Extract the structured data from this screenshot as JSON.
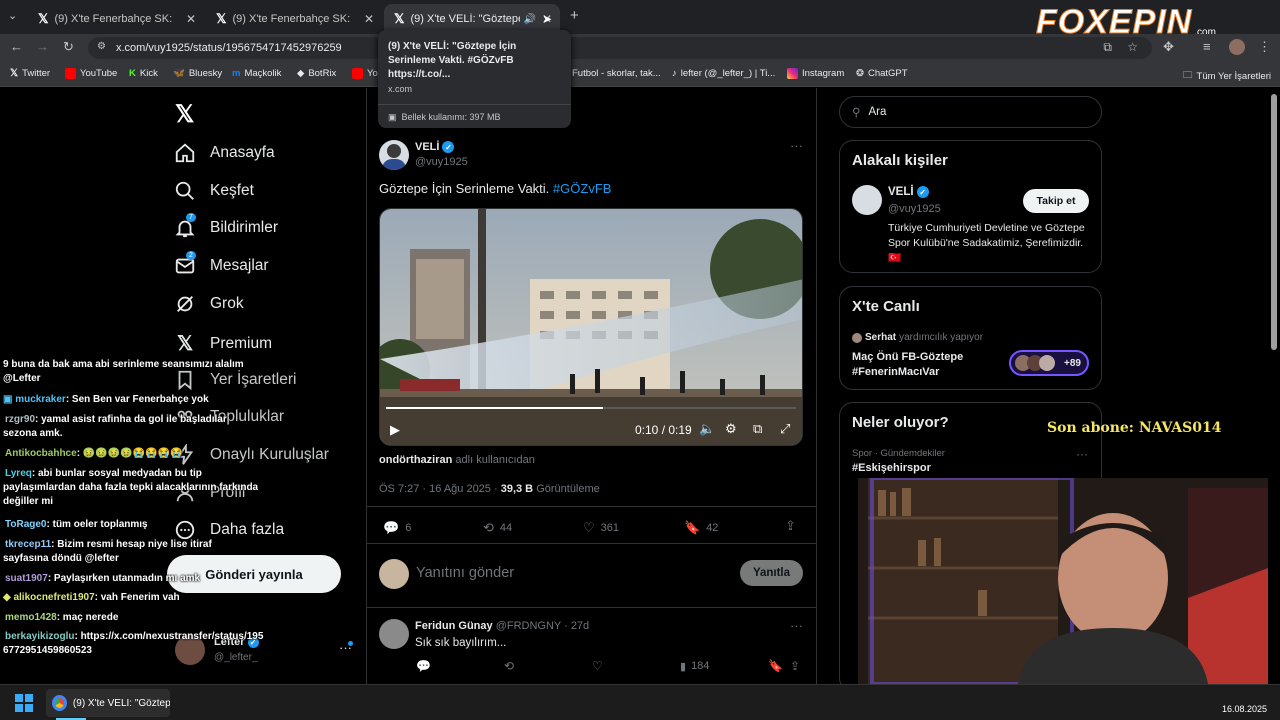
{
  "browser": {
    "tabs": [
      {
        "title": "(9) X'te Fenerbahçe SK: \"Göztepe"
      },
      {
        "title": "(9) X'te Fenerbahçe SK: \"Sen be"
      },
      {
        "title": "(9) X'te VELİ: \"Göztepe İçin"
      }
    ],
    "url": "x.com/vuy1925/status/1956754717452976259",
    "tooltip": {
      "title": "(9) X'te VELİ: \"Göztepe İçin Serinleme Vakti. #GÖZvFB https://t.co/...",
      "domain": "x.com",
      "memory": "Bellek kullanımı: 397 MB"
    },
    "bookmarks": [
      "Twitter",
      "YouTube",
      "Kick",
      "Bluesky",
      "Maçkolik",
      "BotRix",
      "Yo",
      "Futbol - skorlar, tak...",
      "lefter (@_lefter_) | Ti...",
      "Instagram",
      "ChatGPT"
    ],
    "all_bookmarks": "Tüm Yer İşaretleri"
  },
  "brand": {
    "watermark": "FOXEPIN",
    "watermark_suffix": ".com"
  },
  "nav": {
    "items": [
      "Anasayfa",
      "Keşfet",
      "Bildirimler",
      "Mesajlar",
      "Grok",
      "Premium",
      "Yer İşaretleri",
      "Topluluklar",
      "Onaylı Kuruluşlar",
      "Profil",
      "Daha fazla"
    ],
    "bildirim_badge": "7",
    "mesaj_badge": "2",
    "post_button": "Gönderi yayınla",
    "account_name": "Lefter",
    "account_handle": "@_lefter_"
  },
  "tweet": {
    "author": "VELİ",
    "handle": "@vuy1925",
    "text": "Göztepe İçin Serinleme Vakti.",
    "hashtag": "#GÖZvFB",
    "video_time": "0:10 / 0:19",
    "progress": 0.53,
    "attribution_user": "ondörthaziran",
    "attribution_rest": "adlı kullanıcıdan",
    "timestamp": "ÖS 7:27 · 16 Ağu 2025 ·",
    "views": "39,3 B",
    "views_label": "Görüntüleme",
    "replies": "6",
    "retweets": "44",
    "likes": "361",
    "bookmarks": "42",
    "reply_placeholder": "Yanıtını gönder",
    "reply_button": "Yanıtla"
  },
  "reply1": {
    "author": "Feridun Günay",
    "handle": "@FRDNGNY · 27d",
    "text": "Sık sık bayılırım...",
    "views": "184"
  },
  "right": {
    "search_placeholder": "Ara",
    "related_title": "Alakalı kişiler",
    "related_name": "VELİ",
    "related_handle": "@vuy1925",
    "follow_button": "Takip et",
    "related_bio": "Türkiye Cumhuriyeti Devletine ve Göztepe Spor Kulübü'ne Sadakatimiz, Şerefimizdir. 🇹🇷",
    "live_title": "X'te Canlı",
    "live_host": "Serhat",
    "live_host_status": "yardımcılık yapıyor",
    "live_topic": "Maç Önü  FB-Göztepe #FenerinMacıVar",
    "live_count": "+89",
    "trends_title": "Neler oluyor?",
    "trend1_meta": "Spor · Gündemdekiler",
    "trend1_tag": "#Eskişehirspor"
  },
  "stream": {
    "last_sub": "Son abone: NAVAS014"
  },
  "chat": [
    {
      "user": "",
      "color": "#ffffff",
      "msg": "9 buna da bak ama abi serinleme seansımızı alalım @Lefter"
    },
    {
      "user": "muckraker",
      "color": "#4fc3f7",
      "msg": ": Sen Ben var Fenerbahçe yok"
    },
    {
      "user": "rzgr90",
      "color": "#b0bec5",
      "msg": ": yamal asist rafinha da gol ile başladılar sezona amk."
    },
    {
      "user": "Antikocbahhce",
      "color": "#9ccc65",
      "msg": ": 🤢🤢🤢🤢😭😭😭😭"
    },
    {
      "user": "Lyreq",
      "color": "#4dd0e1",
      "msg": ": abi bunlar sosyal medyadan bu tip paylaşımlardan daha fazla tepki alacaklarının farkında değiller mi"
    },
    {
      "user": "ToRage0",
      "color": "#81d4fa",
      "msg": ": tüm oeler toplanmış"
    },
    {
      "user": "tkrecep11",
      "color": "#90caf9",
      "msg": ": Bizim resmi hesap niye lise itiraf sayfasına döndü @lefter"
    },
    {
      "user": "suat1907",
      "color": "#b39ddb",
      "msg": ": Paylaşırken utanmadın mı amk"
    },
    {
      "user": "alikocnefreti1907",
      "color": "#dce775",
      "msg": ": vah Fenerim vah"
    },
    {
      "user": "memo1428",
      "color": "#aed581",
      "msg": ": maç nerede"
    },
    {
      "user": "berkayikizoglu",
      "color": "#80cbc4",
      "msg": ": https://x.com/nexustransfer/status/1956772951459860523"
    }
  ],
  "taskbar": {
    "window_title": "(9) X'te VELİ: \"Göztepe İ",
    "date": "16.08.2025"
  },
  "colors": {
    "accent": "#1d9bf0",
    "bg": "#000000",
    "sub_text": "#f5e663"
  }
}
